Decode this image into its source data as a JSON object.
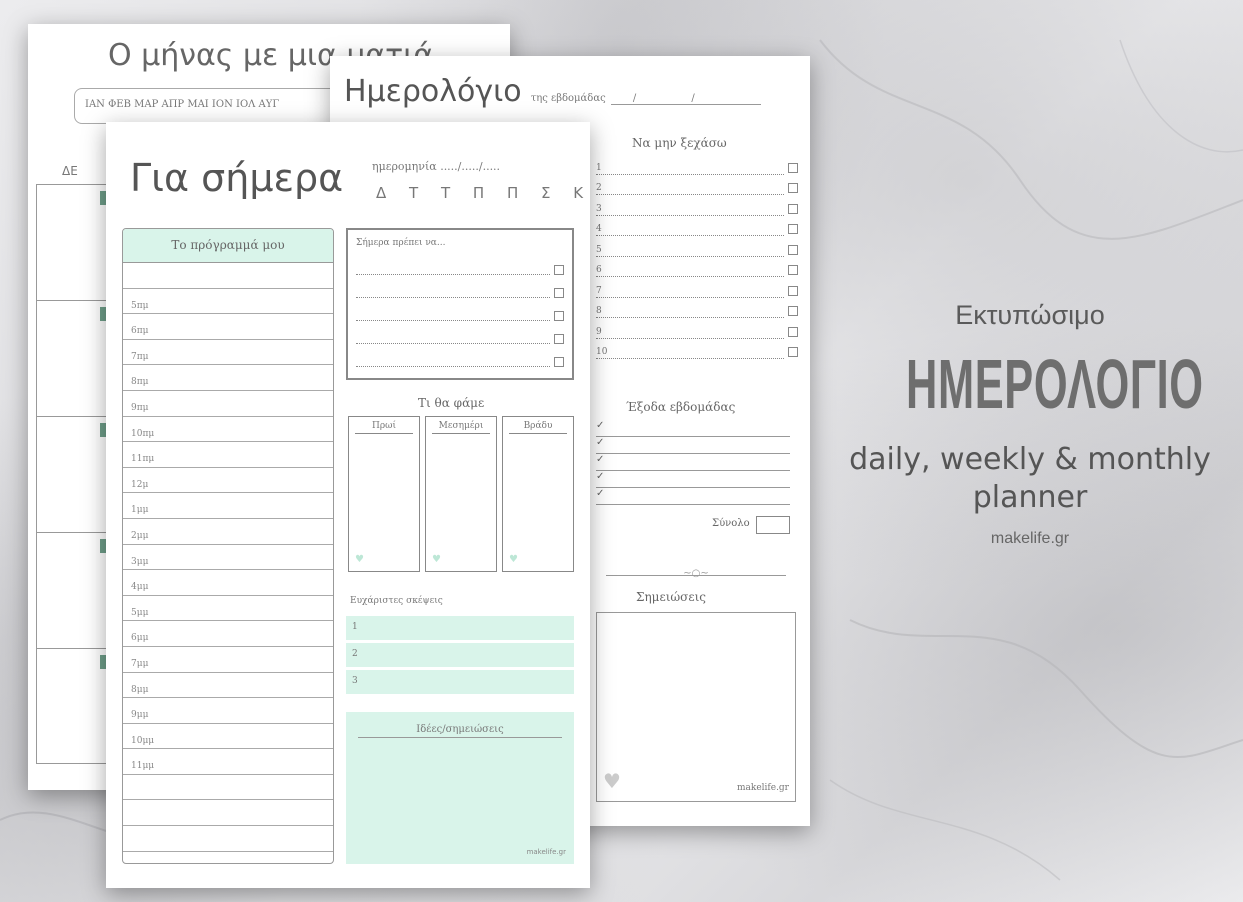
{
  "monthly": {
    "title": "Ο μήνας με μια ματιά",
    "months_bar": "ΙΑΝ ΦΕΒ ΜΑΡ ΑΠΡ ΜΑΙ ΙΟΝ ΙΟΛ ΑΥΓ",
    "day_label": "ΔΕ"
  },
  "weekly": {
    "title": "Ημερολόγιο",
    "subtitle": "της εβδομάδας",
    "date_blank": "/ /",
    "forget_title": "Να μην ξεχάσω",
    "forget_items": [
      "1",
      "2",
      "3",
      "4",
      "5",
      "6",
      "7",
      "8",
      "9",
      "10"
    ],
    "expenses_title": "Έξοδα εβδομάδας",
    "total_label": "Σύνολο",
    "notes_title": "Σημειώσεις",
    "brand": "makelife.gr"
  },
  "daily": {
    "title": "Για σήμερα",
    "date_label": "ημερομηνία ...../...../.....",
    "days": "Δ Τ Τ Π Π Σ Κ",
    "schedule_title": "Το πρόγραμμά μου",
    "slots": [
      "",
      "5πμ",
      "6πμ",
      "7πμ",
      "8πμ",
      "9πμ",
      "10πμ",
      "11πμ",
      "12μ",
      "1μμ",
      "2μμ",
      "3μμ",
      "4μμ",
      "5μμ",
      "6μμ",
      "7μμ",
      "8μμ",
      "9μμ",
      "10μμ",
      "11μμ",
      "",
      "",
      "",
      ""
    ],
    "must_title": "Σήμερα πρέπει να...",
    "food_title": "Τι θα φάμε",
    "meals": [
      "Πρωί",
      "Μεσημέρι",
      "Βράδυ"
    ],
    "thanks_title": "Ευχάριστες σκέψεις",
    "thanks_items": [
      "1",
      "2",
      "3"
    ],
    "ideas_title": "Ιδέες/σημειώσεις",
    "brand": "makelife.gr"
  },
  "promo": {
    "subtitle": "Εκτυπώσιμο",
    "title": "ΗΜΕΡΟΛΟΓΙΟ",
    "english_line1": "daily, weekly & monthly",
    "english_line2": "planner",
    "url": "makelife.gr"
  }
}
